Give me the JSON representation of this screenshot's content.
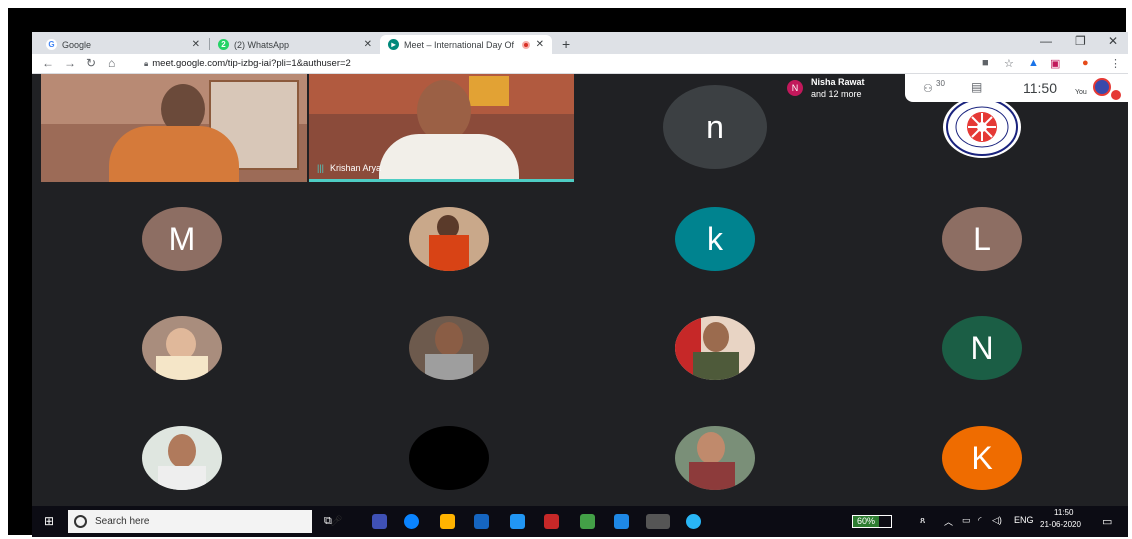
{
  "browser": {
    "tabs": [
      {
        "title": "Google",
        "favicon": "google-icon",
        "active": false
      },
      {
        "title": "(2) WhatsApp",
        "favicon": "whatsapp-icon",
        "active": false
      },
      {
        "title": "Meet – International Day Of",
        "favicon": "meet-icon",
        "active": true,
        "recording": true
      }
    ],
    "close_glyph": "✕",
    "new_tab": "+",
    "url": "meet.google.com/tip-izbg-iai?pli=1&authuser=2",
    "window_controls": [
      "—",
      "❐",
      "✕"
    ]
  },
  "meet": {
    "notification": {
      "initial": "N",
      "line1": "Nisha Rawat",
      "line2": "and 12 more"
    },
    "participants_count": "30",
    "time": "11:50",
    "you_label": "You",
    "video_label": "Krishan Arya",
    "participants": [
      {
        "type": "video",
        "name": ""
      },
      {
        "type": "video",
        "name": "Krishan Arya"
      },
      {
        "type": "avatar",
        "letter": "n",
        "color": "#f4511e"
      },
      {
        "type": "logo",
        "name": "nss-logo"
      },
      {
        "type": "avatar",
        "letter": "M",
        "color": "#8d6e63"
      },
      {
        "type": "photo",
        "name": "participant-photo-6"
      },
      {
        "type": "avatar",
        "letter": "k",
        "color": "#00838f"
      },
      {
        "type": "avatar",
        "letter": "L",
        "color": "#8d6e63"
      },
      {
        "type": "photo",
        "name": "participant-photo-9"
      },
      {
        "type": "photo",
        "name": "participant-photo-10"
      },
      {
        "type": "photo",
        "name": "participant-photo-11"
      },
      {
        "type": "avatar",
        "letter": "N",
        "color": "#1b5e45"
      },
      {
        "type": "photo",
        "name": "participant-photo-13"
      },
      {
        "type": "avatar",
        "letter": "",
        "color": "#000000"
      },
      {
        "type": "photo",
        "name": "participant-photo-15"
      },
      {
        "type": "avatar",
        "letter": "K",
        "color": "#ef6c00"
      }
    ]
  },
  "taskbar": {
    "search_placeholder": "Search here",
    "battery": "60%",
    "language": "ENG",
    "clock_time": "11:50",
    "clock_date": "21-06-2020"
  }
}
